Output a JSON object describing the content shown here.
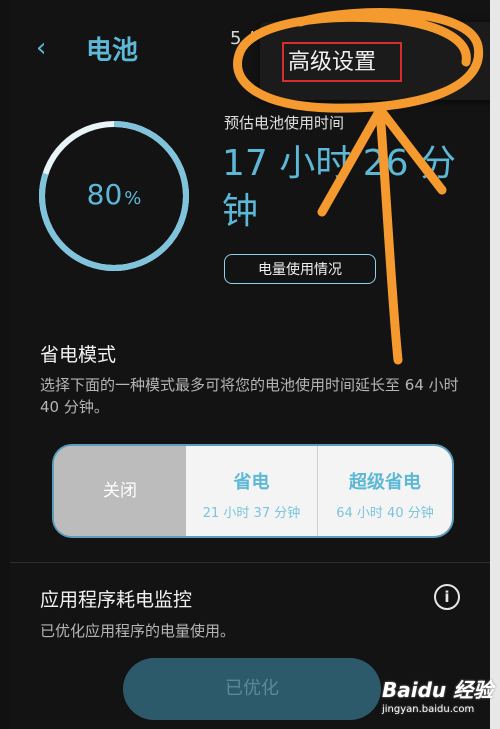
{
  "header": {
    "back_icon": "chevron-left-icon",
    "title": "电池",
    "page_counter": "5 / 6"
  },
  "popup_menu": {
    "item": "高级设置"
  },
  "battery": {
    "percent": "80",
    "percent_unit": "%",
    "level_fraction": 0.8,
    "estimate_label": "预估电池使用时间",
    "estimate_value": "17 小时 26 分钟",
    "usage_button": "电量使用情况"
  },
  "power_saving": {
    "title": "省电模式",
    "description": "选择下面的一种模式最多可将您的电池使用时间延长至 64 小时 40 分钟。",
    "modes": [
      {
        "name": "关闭",
        "time": ""
      },
      {
        "name": "省电",
        "time": "21 小时 37 分钟"
      },
      {
        "name": "超级省电",
        "time": "64 小时 40 分钟"
      }
    ]
  },
  "monitor": {
    "title": "应用程序耗电监控",
    "info_icon": "info-icon",
    "description": "已优化应用程序的电量使用。",
    "button": "已优化"
  },
  "watermark": {
    "logo": "Baidu 经验",
    "sub": "jingyan.baidu.com"
  },
  "colors": {
    "accent": "#5cb8d6",
    "annotation": "#f59a2f",
    "highlight_box": "#d62d2d"
  }
}
